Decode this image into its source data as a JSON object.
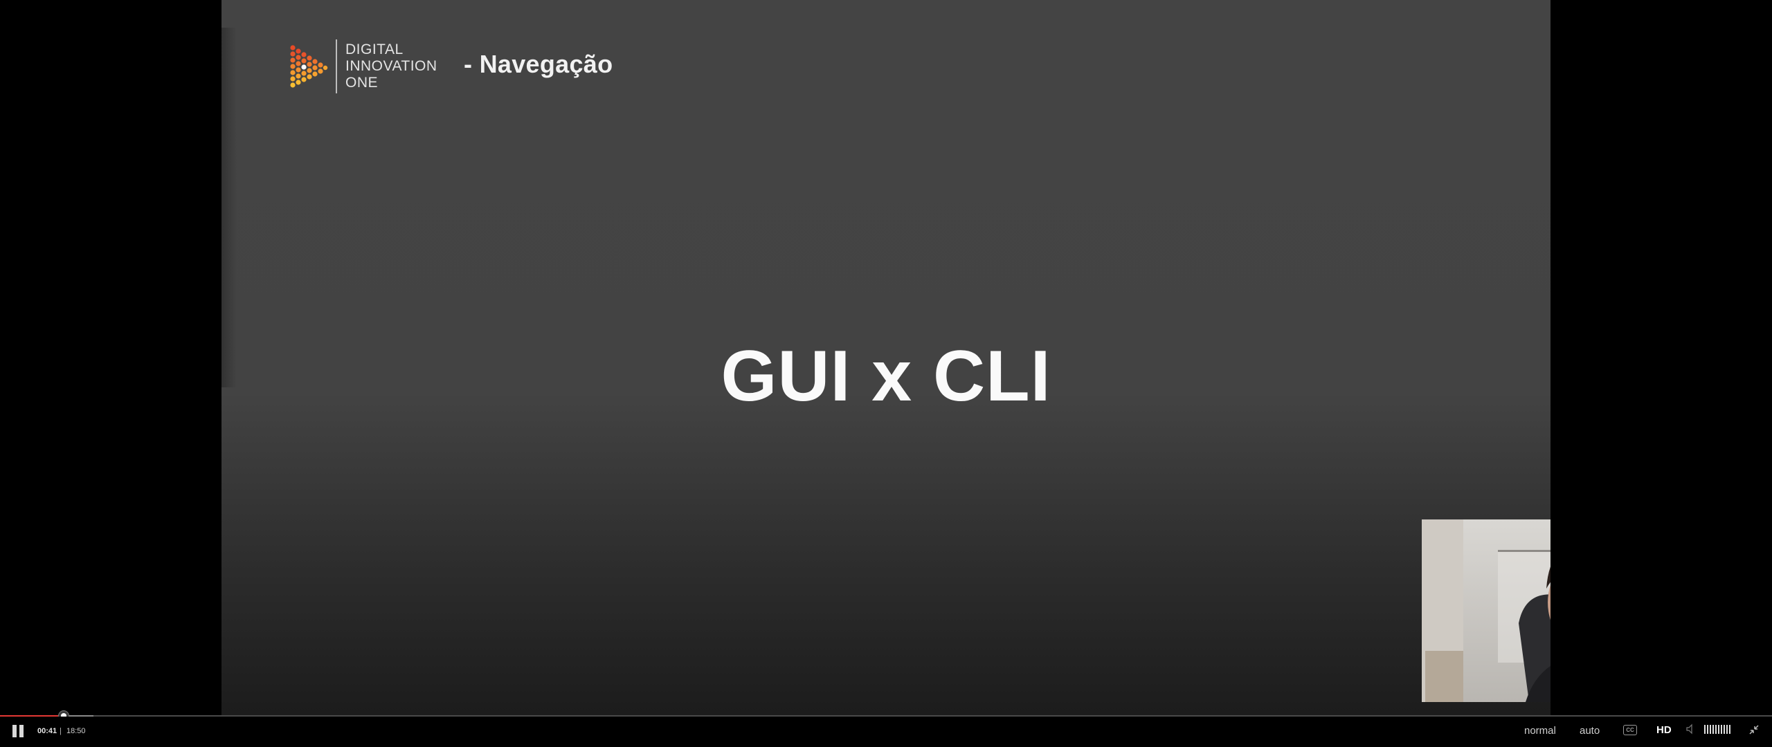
{
  "slide": {
    "logo_lines": [
      "DIGITAL",
      "INNOVATION",
      "ONE"
    ],
    "section_title": "- Navegação",
    "main_title": "GUI x CLI",
    "logo_icon": "play-dots-logo-icon"
  },
  "player": {
    "current_time": "00:41",
    "separator": "|",
    "total_time": "18:50",
    "progress_fraction": 0.036,
    "speed_label": "normal",
    "quality_label": "auto",
    "captions_label": "CC",
    "hd_label": "HD",
    "volume_level": 1.0,
    "icons": [
      "pause-icon",
      "captions-icon",
      "volume-icon",
      "exit-fullscreen-icon"
    ],
    "colors": {
      "played": "#e53935",
      "buffer": "#8a8a8a",
      "track": "#4a4a4a"
    }
  }
}
